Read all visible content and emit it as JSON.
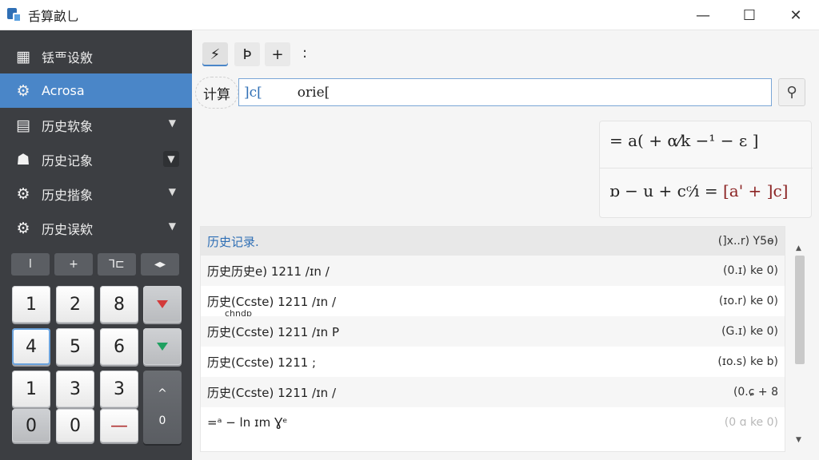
{
  "window": {
    "title": "舌算畝乚",
    "minimize": "—",
    "maximize": "☐",
    "close": "✕"
  },
  "sidebar": {
    "items": [
      {
        "label": "铥覀设敫",
        "icon": "dashboard-icon",
        "chevron": ""
      },
      {
        "label": "Acrosa",
        "icon": "gear-icon",
        "chevron": ""
      },
      {
        "label": "历史软象",
        "icon": "document-icon",
        "chevron": "▼"
      },
      {
        "label": "历史记象",
        "icon": "user-icon",
        "chevron": "▼"
      },
      {
        "label": "历史揩象",
        "icon": "gear-icon",
        "chevron": "▼"
      },
      {
        "label": "历史误欸",
        "icon": "gear-icon",
        "chevron": "▼"
      }
    ]
  },
  "operators": [
    "l",
    "+",
    "⅂⊏",
    "◂▸"
  ],
  "keypad": {
    "r1": [
      "1",
      "2",
      "8"
    ],
    "r2": [
      "4",
      "5",
      "6"
    ],
    "r3": [
      "1",
      "3",
      "3"
    ],
    "r4": [
      "0",
      "0",
      "—"
    ],
    "tall": [
      "^",
      "0"
    ]
  },
  "toolbar": {
    "b1": "⚡",
    "b2": "Ϸ",
    "b3": "+",
    "more": ":"
  },
  "input": {
    "label": "计算",
    "left": "]c[",
    "right": "orie["
  },
  "result": {
    "line1": "= a( + α⁄k −¹ − ɛ ]",
    "line2a": "ɒ − u + cᶜ⁄ı = ",
    "line2b": "[a' + ]c]"
  },
  "history": {
    "title": "历史记录.",
    "header_value": "(]x..r) Y5ɵ)",
    "rows": [
      {
        "expr": "历史历史e) 1211 /ɪn /",
        "value": "(0.ɪ) ke 0)",
        "sub": ""
      },
      {
        "expr": "历史(Ccste) 1211 /ɪn /",
        "value": "(ɪo.r) ke 0)",
        "sub": "chndp"
      },
      {
        "expr": "历史(Ccste) 1211 /ɪn P",
        "value": "(G.ɪ) ke 0)",
        "sub": ""
      },
      {
        "expr": "历史(Ccste) 1211 ;",
        "value": "(ɪo.s) ke b)",
        "sub": ""
      },
      {
        "expr": "历史(Ccste) 1211 /ɪn /",
        "value": "(0.ɕ + 8",
        "sub": ""
      },
      {
        "expr": "=ᵃ − ln ɪm Ɣᵉ",
        "value": "(0 ɑ ke 0)",
        "sub": ""
      }
    ]
  }
}
